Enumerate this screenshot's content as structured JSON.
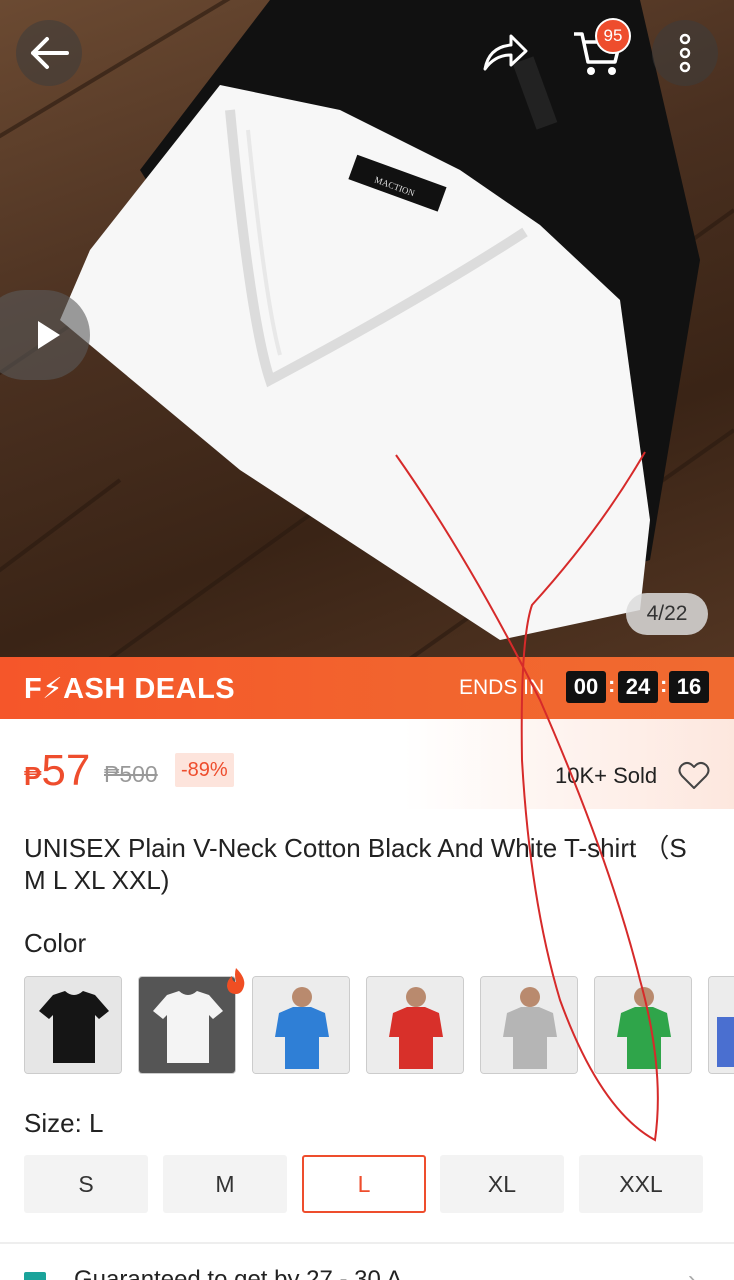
{
  "header": {
    "back_icon": "arrow-left-icon",
    "share_icon": "share-icon",
    "cart_icon": "cart-icon",
    "cart_count": "95",
    "more_icon": "more-vertical-icon"
  },
  "gallery": {
    "counter": "4/22",
    "play_icon": "play-icon",
    "label_text": "MACTION"
  },
  "flash_deals": {
    "title": "F⚡ASH DEALS",
    "ends_in": "ENDS IN",
    "hours": "00",
    "minutes": "24",
    "seconds": "16"
  },
  "price": {
    "currency": "₱",
    "current": "57",
    "original": "₱500",
    "discount": "-89%",
    "sold": "10K+ Sold",
    "favorite_icon": "heart-outline-icon"
  },
  "product": {
    "title": "UNISEX Plain V-Neck Cotton Black And White T-shirt （S M L XL XXL)"
  },
  "color": {
    "label": "Color",
    "options": [
      {
        "name": "black",
        "hex": "#1a1a1a"
      },
      {
        "name": "white",
        "hex": "#f4f4f4"
      },
      {
        "name": "blue",
        "hex": "#2f7fd6"
      },
      {
        "name": "red",
        "hex": "#d8302a"
      },
      {
        "name": "gray",
        "hex": "#b5b5b5"
      },
      {
        "name": "green",
        "hex": "#2fa54a"
      }
    ]
  },
  "size": {
    "label": "Size: L",
    "options": [
      "S",
      "M",
      "L",
      "XL",
      "XXL"
    ],
    "selected": "L"
  },
  "shipping": {
    "text": "Guaranteed to get by 27 - 30 A",
    "chevron": "›"
  },
  "colors": {
    "accent": "#ee4d2d",
    "flash_bg": "#f5562a"
  }
}
